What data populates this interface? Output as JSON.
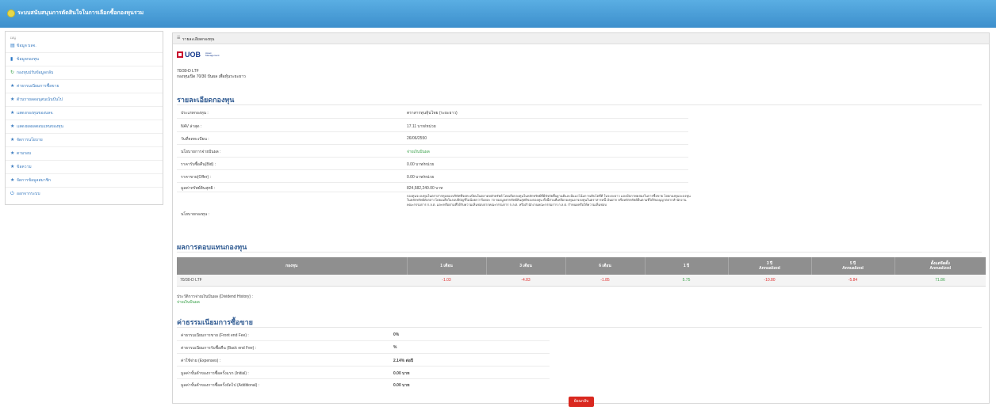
{
  "app": {
    "title": "ระบบสนับสนุนการตัดสินใจในการเลือกซื้อกองทุนรวม"
  },
  "sidebar": {
    "heading": "เมนู",
    "items": [
      {
        "icon": "table-icon",
        "label": "ข้อมูล บลจ."
      },
      {
        "icon": "folder-icon",
        "label": "ข้อมูลกองทุน"
      },
      {
        "icon": "refresh-icon",
        "label": "กองทุนปรับข้อมูลกลับ"
      },
      {
        "icon": "star-icon",
        "label": "ค่าธรรมเนียมการซื้อขาย"
      },
      {
        "icon": "star-icon",
        "label": "ตัวนรายลดอนุสนเน้นปันไป"
      },
      {
        "icon": "star-icon",
        "label": "แสดงกองทุนของบลจ."
      },
      {
        "icon": "star-icon",
        "label": "แสดงผลผลตอบแทนของทุน"
      },
      {
        "icon": "star-icon",
        "label": "จัดการนโยบาย"
      },
      {
        "icon": "star-icon",
        "label": "ตามรอบ"
      },
      {
        "icon": "star-icon",
        "label": "ข้อความ"
      },
      {
        "icon": "star-icon",
        "label": "จัดการข้อมูลสมาชิก"
      },
      {
        "icon": "power-icon",
        "label": "ออกจากระบบ"
      }
    ]
  },
  "panel": {
    "header_title": "รายละเอียดกองทุน",
    "logo_text": "UOB",
    "logo_subtext": "Asset Management",
    "fund_code": "70/30-D LTF",
    "fund_name": "กองทุนเปิด 70/30 ปันผล เพื่อหุ้นระยะยาว",
    "details": {
      "title": "รายละเอียดกองทุน",
      "rows": [
        {
          "label": "ประเภทกองทุน :",
          "value": "ตราสารทุนหุ้นไทย (ระยะยาว)",
          "style": "normal"
        },
        {
          "label": "NAV ล่าสุด :",
          "value": "17.11 บาท/หน่วย",
          "style": "normal"
        },
        {
          "label": "วันที่จดทะเบียน :",
          "value": "26/06/2550",
          "style": "normal"
        },
        {
          "label": "นโยบายการจ่ายปันผล :",
          "value": "จ่ายเงินปันผล",
          "style": "green"
        },
        {
          "label": "ราคารับซื้อคืน(Bid) :",
          "value": "0.00 บาท/หน่วย",
          "style": "normal"
        },
        {
          "label": "ราคาขาย(Offer) :",
          "value": "0.00 บาท/หน่วย",
          "style": "normal"
        },
        {
          "label": "มูลค่าทรัพย์สินสุทธิ :",
          "value": "824,582,240.00 บาท",
          "style": "normal"
        }
      ],
      "objective_label": "นโยบายกองทุน :",
      "objective_text": "กองทุนจะลงทุนในตราสารทุนของบริษัทที่จดทะเบียนในตลาดหลักทรัพย์ โดยเลือกลงทุนในหลักทรัพย์ที่มีปัจจัยพื้นฐานดีและมีแนวโน้มการเติบโตที่ดี ในระยะยาว และมีสภาพคล่องในการซื้อขาย โดยกองทุนจะลงทุนในหลักทรัพย์ดังกล่าวโดยเฉลี่ยในรอบปีบัญชีไม่น้อยกว่าร้อยละ 70 ของมูลค่าทรัพย์สินสุทธิของกองทุน ทั้งนี้ส่วนที่เหลือกองทุนอาจลงทุนในตราสารหนี้ เงินฝาก หรือหลักทรัพย์อื่นตามที่ได้รับอนุญาตจากสำนักงานคณะกรรมการ ก.ล.ต. และ/หรือตามที่ได้รับความเห็นชอบจากคณะกรรมการ ก.ล.ต. หรือสำนักงานคณะกรรมการ ก.ล.ต. กำหนดหรือให้ความเห็นชอบ"
    },
    "performance": {
      "title": "ผลการตอบแทนกองทุน",
      "columns": [
        {
          "line1": "กองทุน",
          "line2": ""
        },
        {
          "line1": "1 เดือน",
          "line2": ""
        },
        {
          "line1": "3 เดือน",
          "line2": ""
        },
        {
          "line1": "6 เดือน",
          "line2": ""
        },
        {
          "line1": "1 ปี",
          "line2": ""
        },
        {
          "line1": "3 ปี",
          "line2": "Annualized"
        },
        {
          "line1": "5 ปี",
          "line2": "Annualized"
        },
        {
          "line1": "ตั้งแต่จัดตั้ง",
          "line2": "Annualized"
        }
      ],
      "row": {
        "fund": "70/30-D LTF",
        "values": [
          "-1.03",
          "-4.83",
          "-1.85",
          "5.75",
          "-10.80",
          "-5.84",
          "71.86"
        ],
        "signs": [
          "neg",
          "neg",
          "neg",
          "pos",
          "neg",
          "neg",
          "pos"
        ]
      }
    },
    "dividend_history": {
      "label": "ประวัติการจ่ายเงินปันผล (Dividend History) :",
      "value": "จ่ายเงินปันผล"
    },
    "fees": {
      "title": "ค่าธรรมเนียมการซื้อขาย",
      "rows": [
        {
          "label": "ค่าธรรมเนียมการขาย (Front end Fee) :",
          "value": "0%"
        },
        {
          "label": "ค่าธรรมเนียมการรับซื้อคืน (Back end Fee) :",
          "value": "%"
        },
        {
          "label": "ค่าใช้จ่าย (Expenses) :",
          "value": "2.14% ต่อปี"
        },
        {
          "label": "มูลค่าขั้นต่ำของการซื้อครั้งแรก (Initial) :",
          "value": "0.00 บาท"
        },
        {
          "label": "มูลค่าขั้นต่ำของการซื้อครั้งถัดไป (Additional) :",
          "value": "0.00 บาท"
        }
      ]
    },
    "back_label": "ย้อนกลับ"
  }
}
